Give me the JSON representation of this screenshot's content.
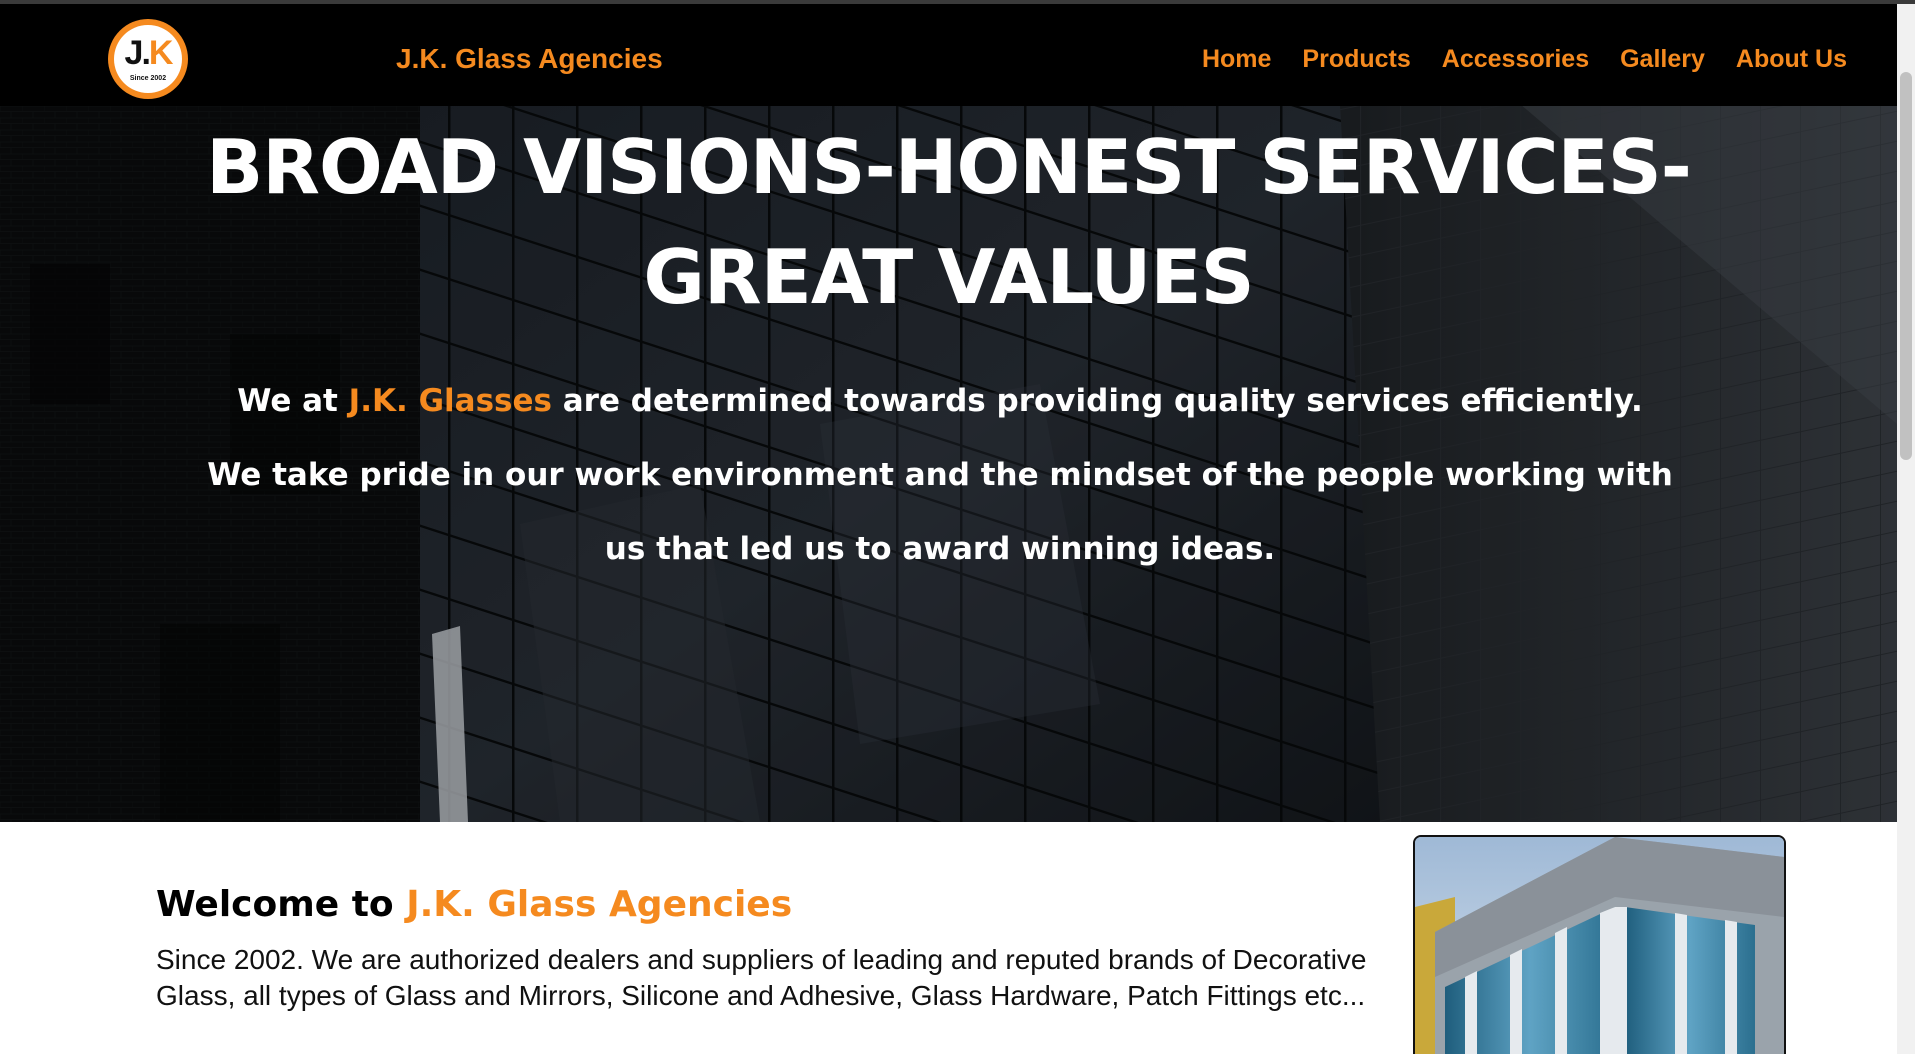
{
  "navbar": {
    "logo": {
      "mark_j": "J",
      "mark_dot": ".",
      "mark_k": "K",
      "since": "Since 2002"
    },
    "brand": "J.K. Glass Agencies",
    "links": [
      "Home",
      "Products",
      "Accessories",
      "Gallery",
      "About Us"
    ]
  },
  "hero": {
    "title_line1": "BROAD VISIONS-HONEST SERVICES-",
    "title_line2": "GREAT VALUES",
    "p1_prefix": "We at ",
    "p1_accent": "J.K. Glasses",
    "p1_suffix": " are determined towards providing quality services efficiently.",
    "p2": "We take pride in our work environment and the mindset of the people working with us that led us to award winning ideas."
  },
  "welcome": {
    "heading_prefix": "Welcome to ",
    "heading_accent": "J.K. Glass Agencies",
    "text": "Since 2002. We are authorized dealers and suppliers of leading and reputed brands of Decorative Glass, all types of Glass and Mirrors, Silicone and Adhesive, Glass Hardware, Patch Fittings etc..."
  },
  "colors": {
    "accent": "#f58a1f",
    "navbar": "#000000",
    "hero_text": "#ffffff"
  },
  "icons": {
    "logo": "jk-logo-icon",
    "building_photo": "glass-building-image"
  }
}
